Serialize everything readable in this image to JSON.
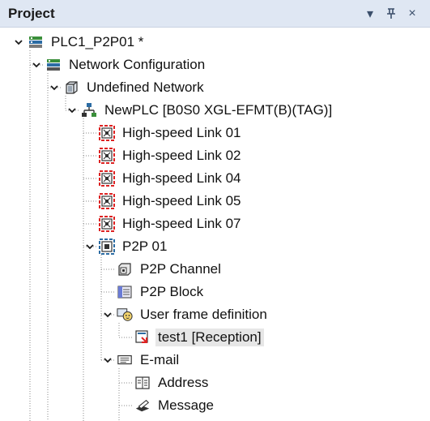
{
  "panel": {
    "title": "Project",
    "buttons": {
      "menu": "▾",
      "pin": "ᵖ",
      "close": "×"
    }
  },
  "tree": [
    {
      "label": "PLC1_P2P01 *",
      "depth": 0,
      "expanded": true,
      "icon": "project-icon"
    },
    {
      "label": "Network Configuration",
      "depth": 1,
      "expanded": true,
      "icon": "network-config-icon"
    },
    {
      "label": "Undefined Network",
      "depth": 2,
      "expanded": true,
      "icon": "undefined-network-icon"
    },
    {
      "label": "NewPLC [B0S0 XGL-EFMT(B)(TAG)]",
      "depth": 3,
      "expanded": true,
      "icon": "plc-module-icon"
    },
    {
      "label": "High-speed Link 01",
      "depth": 4,
      "icon": "high-speed-link-icon"
    },
    {
      "label": "High-speed Link 02",
      "depth": 4,
      "icon": "high-speed-link-icon"
    },
    {
      "label": "High-speed Link 04",
      "depth": 4,
      "icon": "high-speed-link-icon"
    },
    {
      "label": "High-speed Link 05",
      "depth": 4,
      "icon": "high-speed-link-icon"
    },
    {
      "label": "High-speed Link 07",
      "depth": 4,
      "icon": "high-speed-link-icon"
    },
    {
      "label": "P2P 01",
      "depth": 4,
      "expanded": true,
      "icon": "p2p-icon"
    },
    {
      "label": "P2P Channel",
      "depth": 5,
      "icon": "p2p-channel-icon"
    },
    {
      "label": "P2P Block",
      "depth": 5,
      "icon": "p2p-block-icon"
    },
    {
      "label": "User frame definition",
      "depth": 5,
      "expanded": true,
      "icon": "user-frame-icon"
    },
    {
      "label": "test1 [Reception]",
      "depth": 6,
      "selected": true,
      "icon": "frame-reception-icon"
    },
    {
      "label": "E-mail",
      "depth": 5,
      "expanded": true,
      "icon": "email-icon"
    },
    {
      "label": "Address",
      "depth": 6,
      "icon": "address-book-icon"
    },
    {
      "label": "Message",
      "depth": 6,
      "icon": "message-icon"
    }
  ]
}
